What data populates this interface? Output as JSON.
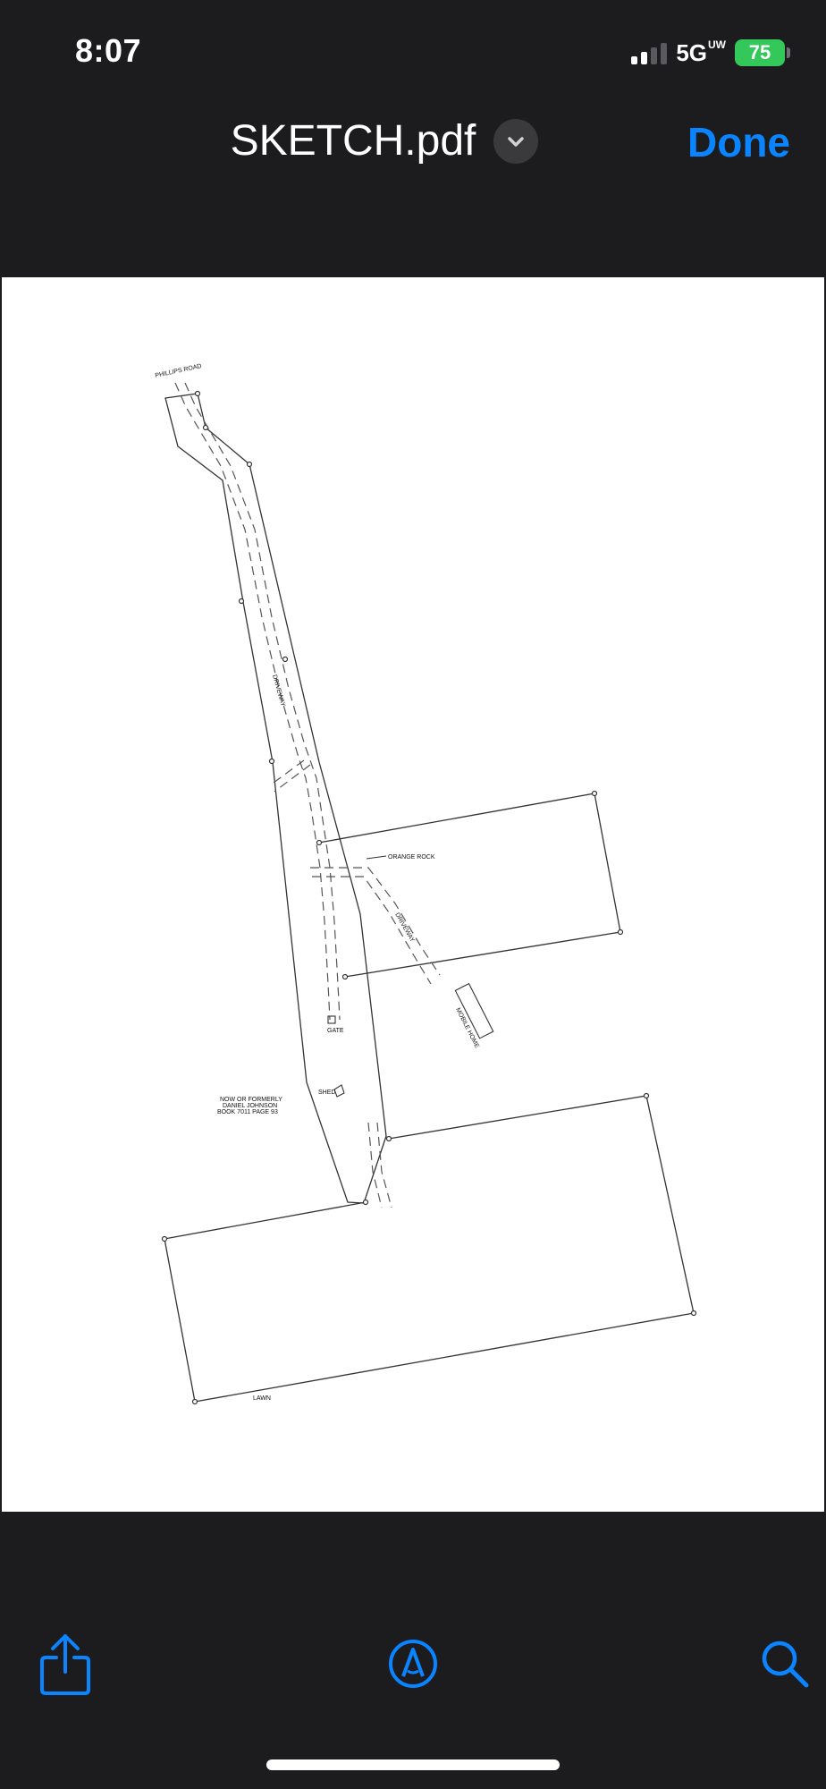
{
  "status_bar": {
    "time": "8:07",
    "network": "5G",
    "network_badge": "UW",
    "battery": "75"
  },
  "nav": {
    "title": "SKETCH.pdf",
    "done_label": "Done"
  },
  "sketch": {
    "labels": {
      "road": "PHILLIPS ROAD",
      "driveway": "DRIVEWAY",
      "shed": "SHED",
      "gate": "GATE",
      "lawn": "LAWN",
      "orange_rock": "ORANGE ROCK",
      "mobile_home": "MOBILE HOME",
      "owner_line1": "NOW OR FORMERLY",
      "owner_line2": "DANIEL JOHNSON",
      "owner_line3": "BOOK 7011 PAGE 93"
    }
  },
  "toolbar": {
    "share_icon": "share-icon",
    "markup_icon": "markup-icon",
    "search_icon": "search-icon"
  },
  "colors": {
    "background": "#1c1c1e",
    "accent": "#0a84ff",
    "battery": "#34c759"
  }
}
